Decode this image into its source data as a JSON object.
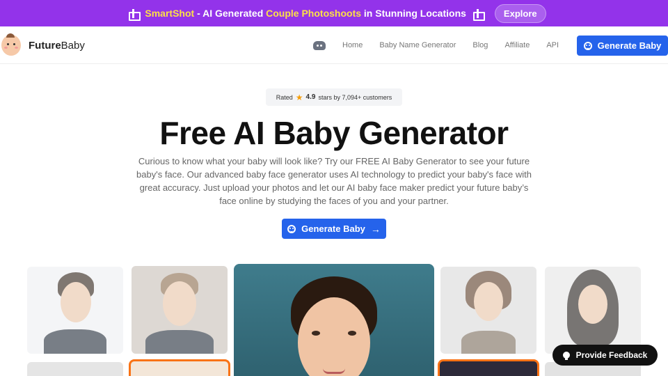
{
  "banner": {
    "brand": "SmartShot",
    "text_mid": " - AI Generated ",
    "highlight": "Couple Photoshoots",
    "text_end": " in Stunning Locations",
    "explore_label": "Explore"
  },
  "nav": {
    "logo_bold": "Future",
    "logo_rest": "Baby",
    "links": [
      "Home",
      "Baby Name Generator",
      "Blog",
      "Affiliate",
      "API"
    ],
    "cta_label": "Generate Baby"
  },
  "hero": {
    "rated_prefix": "Rated",
    "rating": "4.9",
    "rated_suffix": "stars by 7,094+ customers",
    "title": "Free AI Baby Generator",
    "description": "Curious to know what your baby will look like? Try our FREE AI Baby Generator to see your future baby's face. Our advanced baby face generator uses AI technology to predict your baby's face with great accuracy. Just upload your photos and let our AI baby face maker predict your future baby’s face online by studying the faces of you and your partner.",
    "cta_label": "Generate Baby",
    "cta_arrow": "→"
  },
  "feedback": {
    "label": "Provide Feedback"
  },
  "icons": {
    "banner_left": "gift-icon",
    "banner_right": "gift-icon",
    "discord": "discord-icon",
    "baby": "baby-face-icon",
    "star": "star-icon",
    "bulb": "lightbulb-icon"
  },
  "colors": {
    "banner_bg": "#9333ea",
    "banner_highlight": "#fde047",
    "primary": "#2563eb",
    "accent_frame": "#f97316",
    "feedback_bg": "#111111",
    "star": "#f59e0b"
  }
}
